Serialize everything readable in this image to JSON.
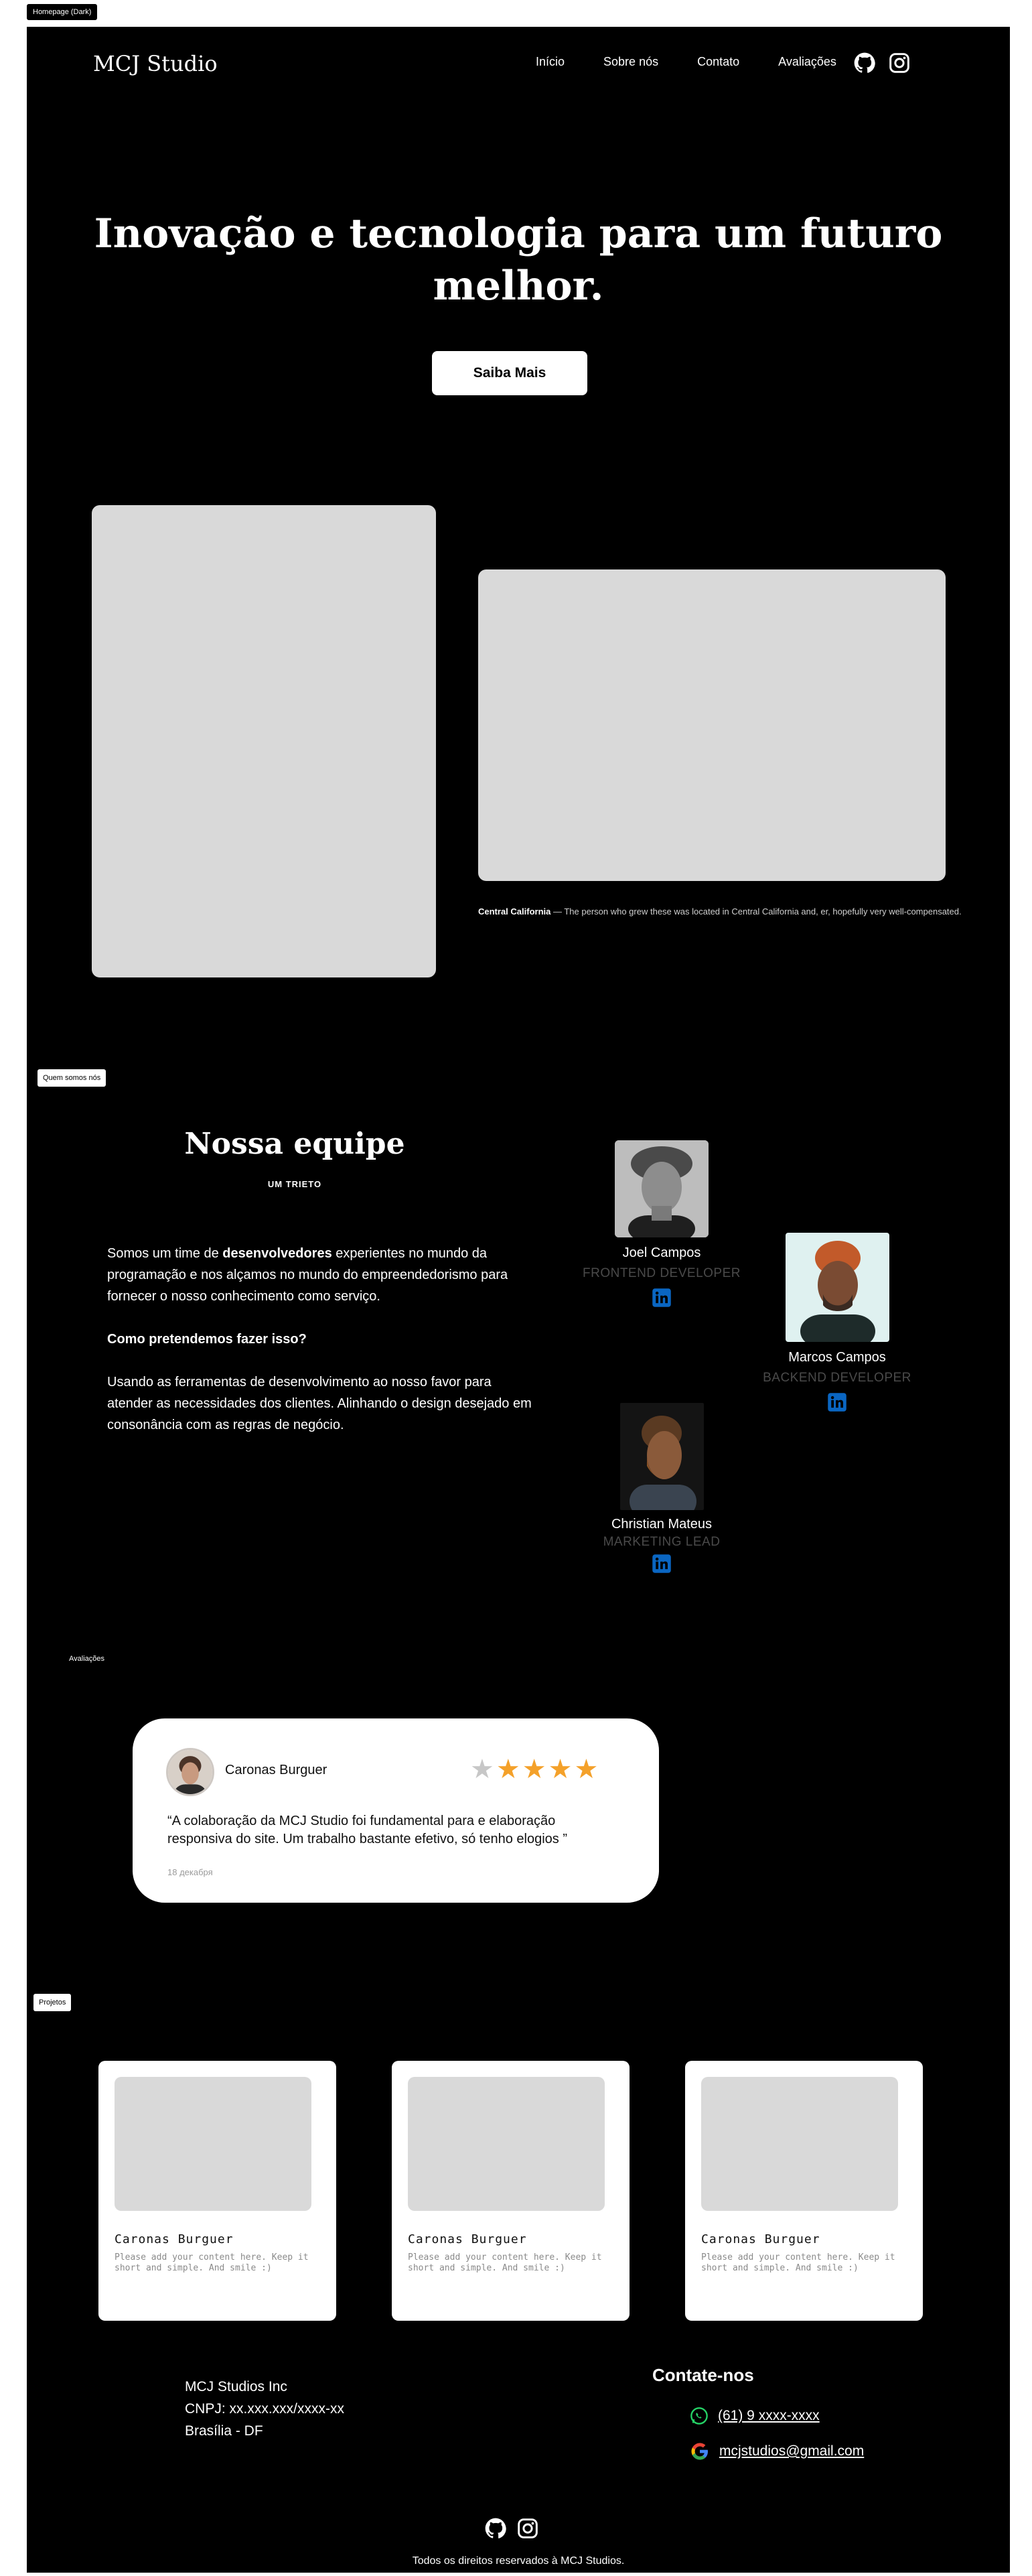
{
  "frame_label": "Homepage (Dark)",
  "header": {
    "logo": "MCJ Studio",
    "nav": [
      "Início",
      "Sobre nós",
      "Contato",
      "Avaliações"
    ],
    "icons": [
      "github-icon",
      "instagram-icon"
    ]
  },
  "hero": {
    "title_line1": "Inovação e tecnologia para um futuro",
    "title_line2": "melhor.",
    "button": "Saiba Mais",
    "caption_bold": "Central California",
    "caption_rest": " — The person who grew these was located in Central California and, er, hopefully very well-compensated."
  },
  "about": {
    "section_tag": "Quem somos nós",
    "title": "Nossa equipe",
    "subtitle": "UM TRIETO",
    "p1_before": "Somos um time de ",
    "p1_bold": "desenvolvedores",
    "p1_after": " experientes no mundo da programação e nos alçamos no mundo do empreendedorismo para fornecer o nosso conhecimento como serviço.",
    "question": "Como pretendemos fazer isso?",
    "p2": "Usando as ferramentas de desenvolvimento ao nosso favor para atender as necessidades dos clientes. Alinhando o design desejado em consonância com as regras de negócio.",
    "members": [
      {
        "name": "Joel Campos",
        "role": "FRONTEND DEVELOPER"
      },
      {
        "name": "Marcos Campos",
        "role": "BACKEND DEVELOPER"
      },
      {
        "name": "Christian Mateus",
        "role": "MARKETING LEAD"
      }
    ]
  },
  "reviews": {
    "section_tag": "Avaliações",
    "items": [
      {
        "name": "Caronas Burguer",
        "rating": 4,
        "text": "“A colaboração da MCJ Studio foi fundamental para e elaboração responsiva do site. Um trabalho bastante efetivo, só tenho elogios ”",
        "date": "18 декабря"
      }
    ]
  },
  "projects": {
    "section_tag": "Projetos",
    "items": [
      {
        "title": "Caronas Burguer",
        "desc": "Please add your content here. Keep it short and simple. And smile :)"
      },
      {
        "title": "Caronas Burguer",
        "desc": "Please add your content here. Keep it short and simple. And smile :)"
      },
      {
        "title": "Caronas Burguer",
        "desc": "Please add your content here. Keep it short and simple. And smile :)"
      }
    ]
  },
  "footer": {
    "company": "MCJ Studios Inc",
    "cnpj": "CNPJ: xx.xxx.xxx/xxxx-xx",
    "city": "Brasília - DF",
    "contact_title": "Contate-nos",
    "phone": "(61) 9 xxxx-xxxx",
    "email": "mcjstudios@gmail.com",
    "copyright": "Todos os direitos reservados à MCJ Studios."
  },
  "colors": {
    "background": "#000000",
    "card": "#ffffff",
    "placeholder": "#d9d9d9",
    "star": "#f4a12a",
    "star_empty": "#c7c7c7",
    "linkedin": "#0a66c2",
    "whatsapp": "#25d366"
  }
}
